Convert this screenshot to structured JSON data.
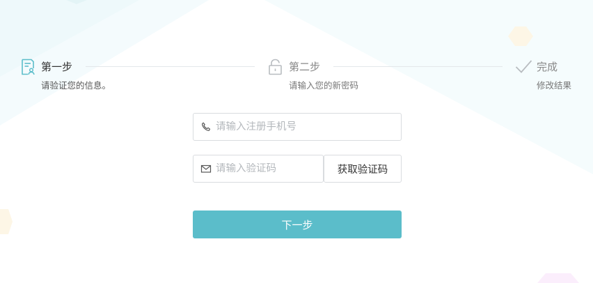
{
  "steps": [
    {
      "title": "第一步",
      "desc": "请验证您的信息。",
      "icon": "document-user-icon",
      "state": "active"
    },
    {
      "title": "第二步",
      "desc": "请输入您的新密码",
      "icon": "unlock-icon",
      "state": "pending"
    },
    {
      "title": "完成",
      "desc": "修改结果",
      "icon": "checkmark-icon",
      "state": "pending"
    }
  ],
  "form": {
    "phone_placeholder": "请输入注册手机号",
    "code_placeholder": "请输入验证码",
    "get_code_label": "获取验证码",
    "next_label": "下一步"
  },
  "colors": {
    "accent": "#5bbdca",
    "active_text": "#333333",
    "inactive_text": "#888888",
    "border": "#d9dcdf",
    "divider": "#e3e7ea",
    "placeholder": "#b4b8bc"
  }
}
